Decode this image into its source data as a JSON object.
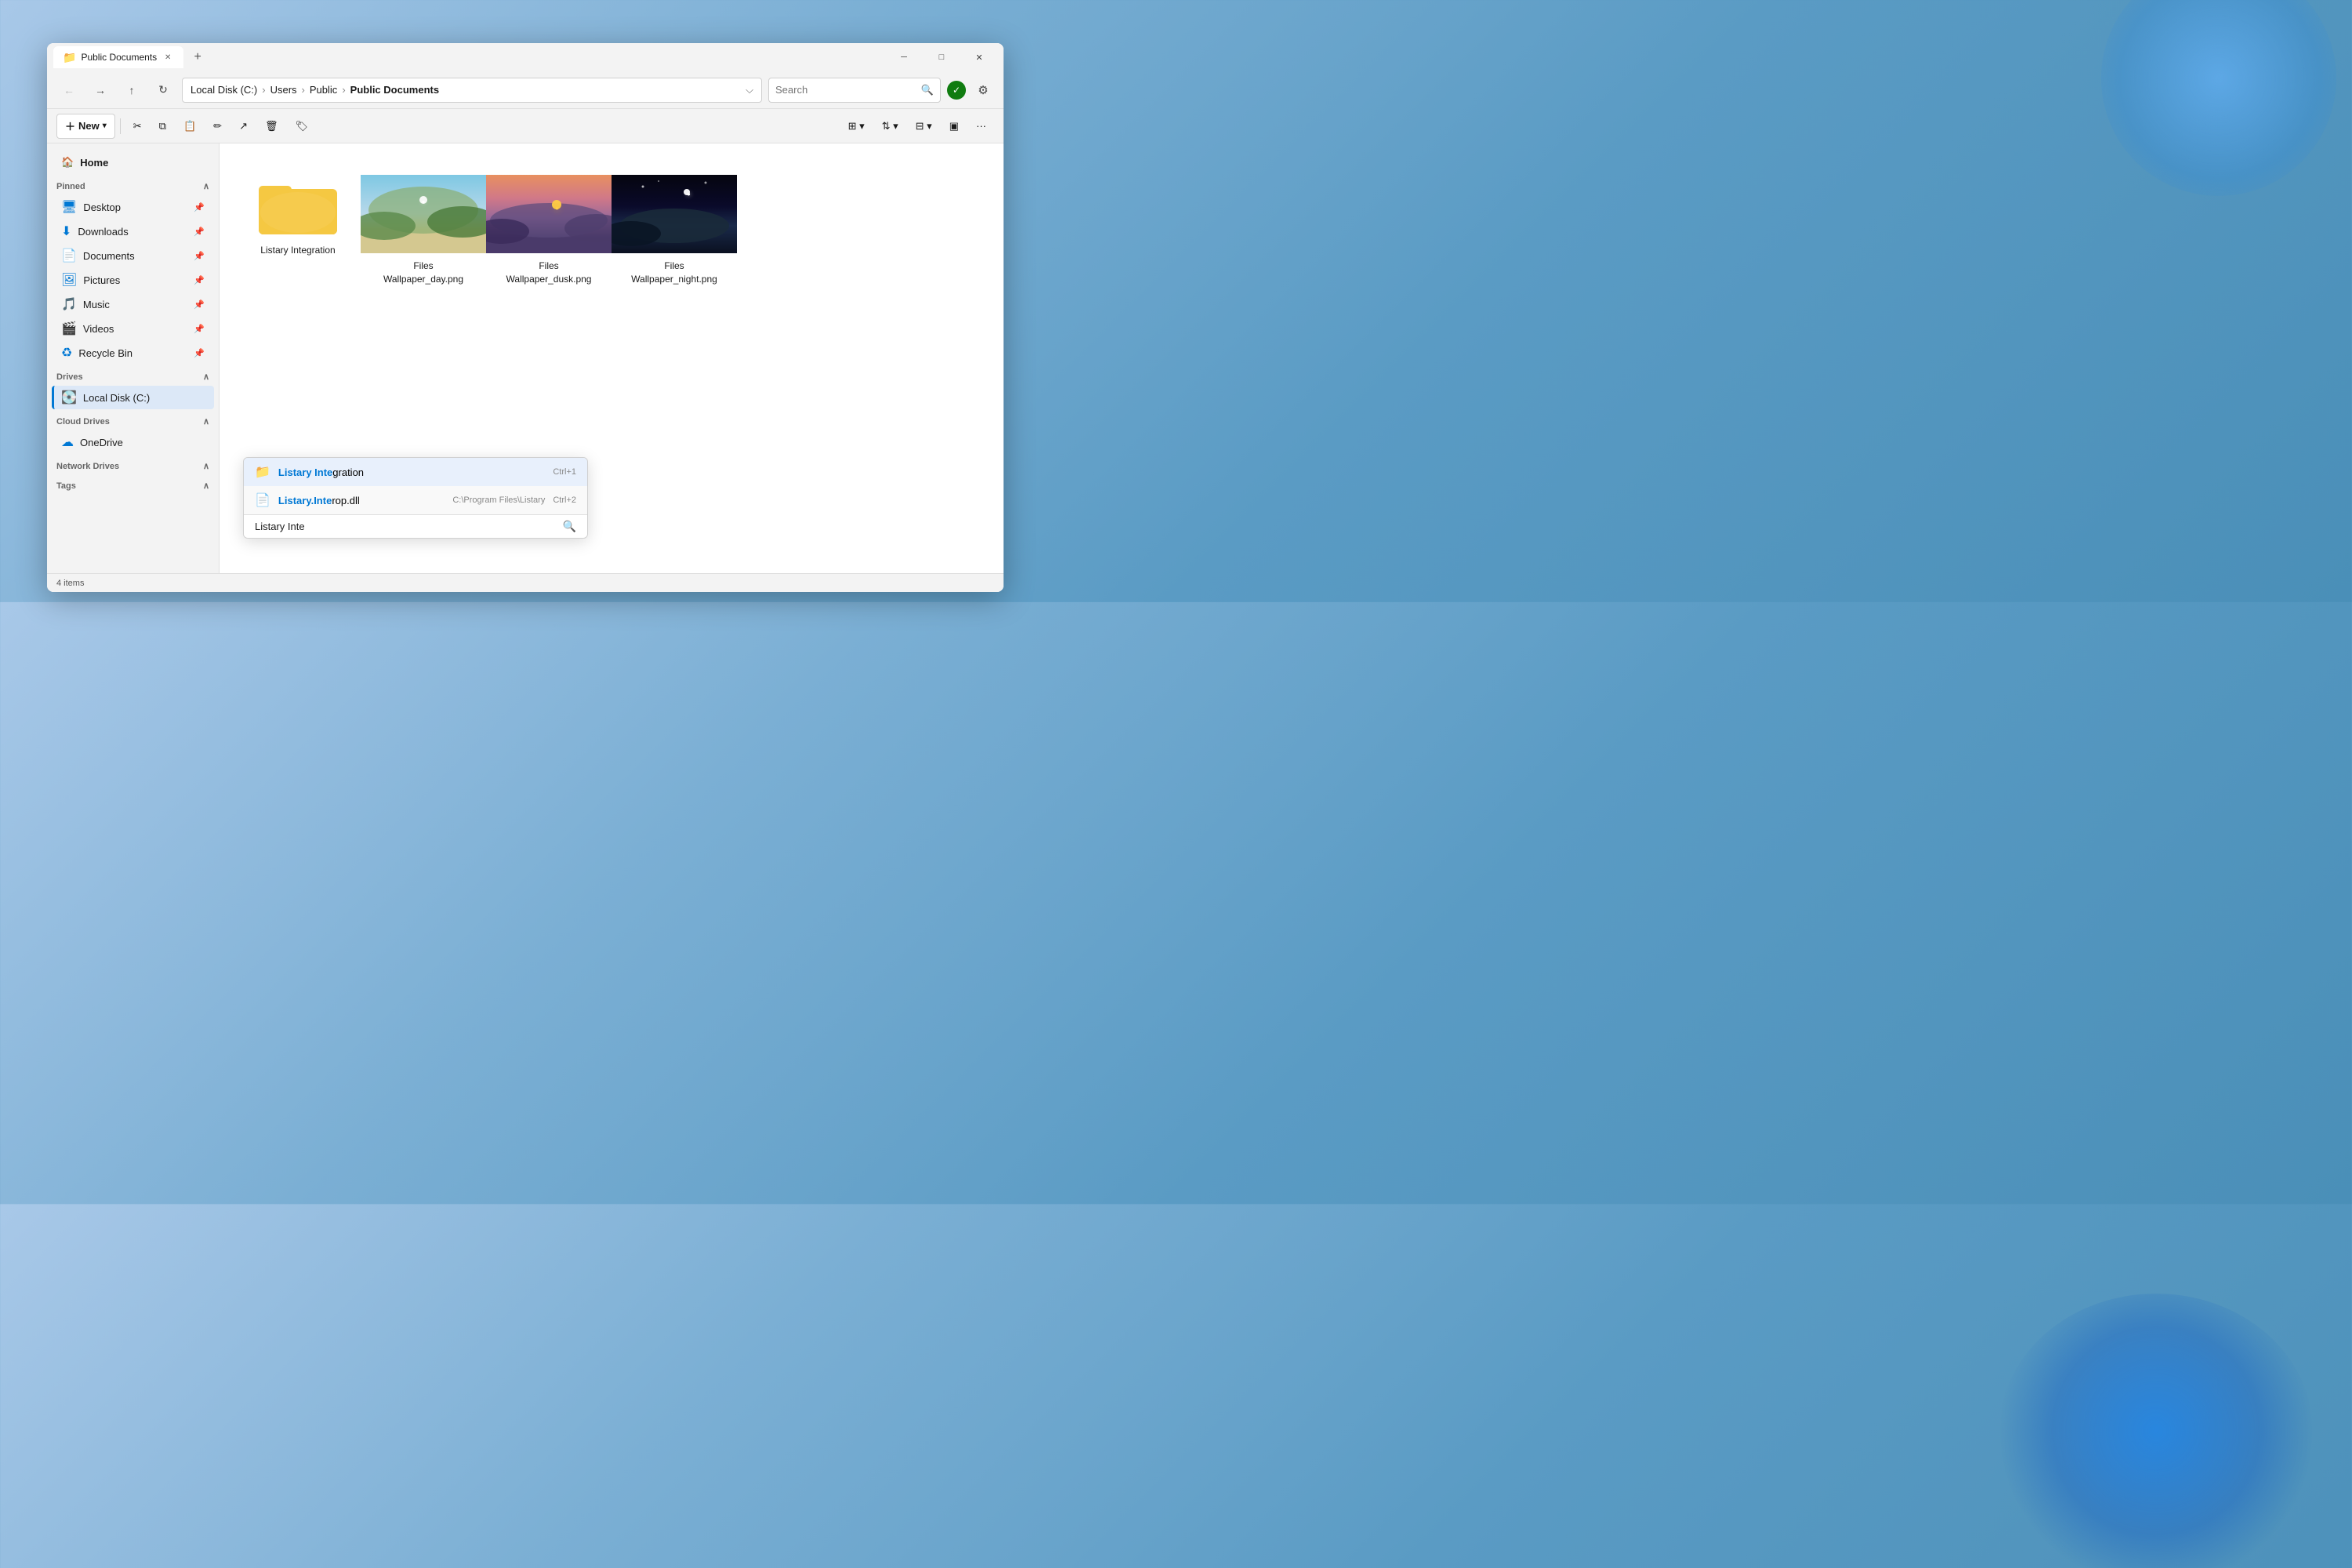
{
  "window": {
    "title": "Public Documents",
    "tab_label": "Public Documents",
    "tab_icon": "📁"
  },
  "address_bar": {
    "breadcrumbs": [
      "Local Disk (C:)",
      "Users",
      "Public",
      "Public Documents"
    ],
    "search_placeholder": "Search",
    "search_value": ""
  },
  "toolbar": {
    "new_label": "New",
    "new_icon": "＋",
    "buttons": [
      {
        "id": "cut",
        "icon": "✂",
        "label": "Cut"
      },
      {
        "id": "copy",
        "icon": "⧉",
        "label": "Copy"
      },
      {
        "id": "paste",
        "icon": "📋",
        "label": "Paste"
      },
      {
        "id": "rename",
        "icon": "✏",
        "label": "Rename"
      },
      {
        "id": "share",
        "icon": "↗",
        "label": "Share"
      },
      {
        "id": "delete",
        "icon": "🗑",
        "label": "Delete"
      },
      {
        "id": "pin",
        "icon": "📌",
        "label": "Pin"
      }
    ]
  },
  "sidebar": {
    "home_label": "Home",
    "sections": [
      {
        "id": "pinned",
        "label": "Pinned",
        "items": [
          {
            "id": "desktop",
            "label": "Desktop",
            "icon": "🖥",
            "color": "#0078d4"
          },
          {
            "id": "downloads",
            "label": "Downloads",
            "icon": "⬇",
            "color": "#0078d4"
          },
          {
            "id": "documents",
            "label": "Documents",
            "icon": "📄",
            "color": "#0078d4"
          },
          {
            "id": "pictures",
            "label": "Pictures",
            "icon": "🖼",
            "color": "#0078d4"
          },
          {
            "id": "music",
            "label": "Music",
            "icon": "🎵",
            "color": "#e74856"
          },
          {
            "id": "videos",
            "label": "Videos",
            "icon": "🎬",
            "color": "#744da9"
          },
          {
            "id": "recycle",
            "label": "Recycle Bin",
            "icon": "♻",
            "color": "#0078d4"
          }
        ]
      },
      {
        "id": "drives",
        "label": "Drives",
        "items": [
          {
            "id": "local_disk",
            "label": "Local Disk (C:)",
            "icon": "💽",
            "active": true
          }
        ]
      },
      {
        "id": "cloud_drives",
        "label": "Cloud Drives",
        "items": [
          {
            "id": "onedrive",
            "label": "OneDrive",
            "icon": "☁",
            "color": "#0078d4"
          }
        ]
      },
      {
        "id": "network_drives",
        "label": "Network Drives",
        "items": []
      },
      {
        "id": "tags",
        "label": "Tags",
        "items": []
      }
    ]
  },
  "content": {
    "items": [
      {
        "id": "listary_integration",
        "name": "Listary Integration",
        "type": "folder"
      },
      {
        "id": "wallpaper_day",
        "name": "Files Wallpaper_day.png",
        "type": "image_day"
      },
      {
        "id": "wallpaper_dusk",
        "name": "Files Wallpaper_dusk.png",
        "type": "image_dusk"
      },
      {
        "id": "wallpaper_night",
        "name": "Files Wallpaper_night.png",
        "type": "image_night"
      }
    ]
  },
  "status_bar": {
    "item_count": "4 items"
  },
  "autocomplete": {
    "items": [
      {
        "id": "listary_folder",
        "icon": "📁",
        "text_before": "Listary Inte",
        "text_after": "gration",
        "path": "",
        "shortcut": "Ctrl+1"
      },
      {
        "id": "listary_dll",
        "icon": "📄",
        "text_before": "Listary.Inte",
        "text_after": "rop.dll",
        "path": "C:\\Program Files\\Listary",
        "shortcut": "Ctrl+2"
      }
    ],
    "search_value": "Listary Inte"
  }
}
